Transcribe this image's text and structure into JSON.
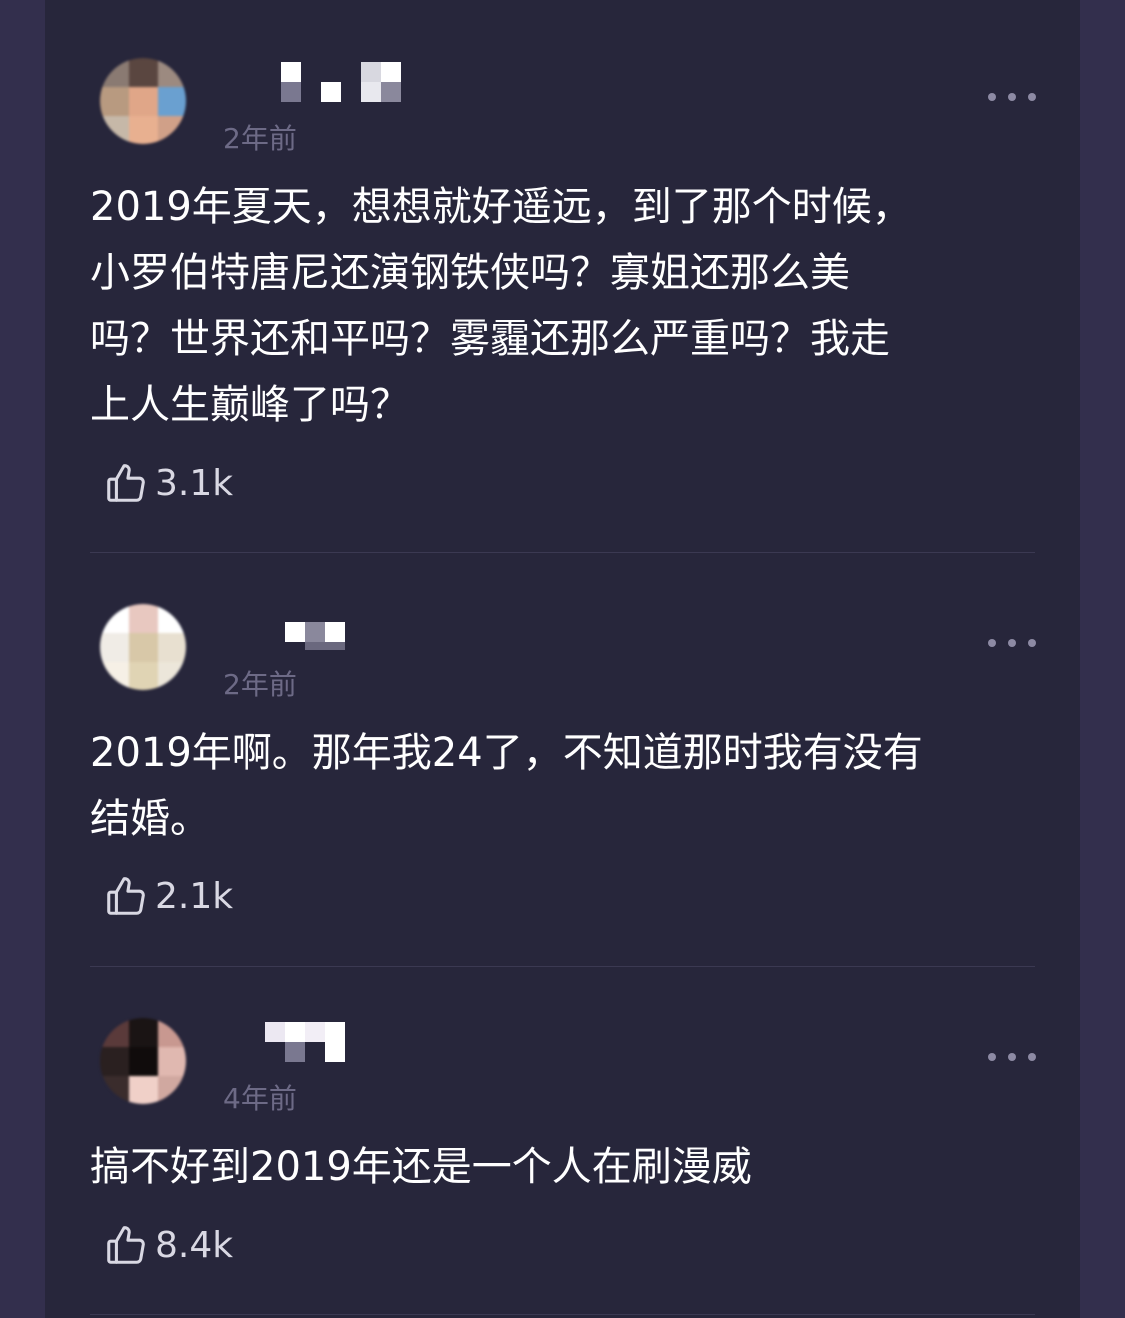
{
  "comments": [
    {
      "time": "2年前",
      "text": "2019年夏天，想想就好遥远，到了那个时候，\n小罗伯特唐尼还演钢铁侠吗？寡姐还那么美\n吗？世界还和平吗？雾霾还那么严重吗？我走\n上人生巅峰了吗？",
      "likes": "3.1k"
    },
    {
      "time": "2年前",
      "text": "2019年啊。那年我24了，不知道那时我有没有\n结婚。",
      "likes": "2.1k"
    },
    {
      "time": "4年前",
      "text": "搞不好到2019年还是一个人在刷漫威",
      "likes": "8.4k"
    }
  ],
  "icons": {
    "more": "more-dots-icon",
    "like": "thumbs-up-icon"
  },
  "colors": {
    "page_bg": "#27263b",
    "side_bg": "#332f4d",
    "text": "#ffffff",
    "time": "#6d6a86"
  }
}
